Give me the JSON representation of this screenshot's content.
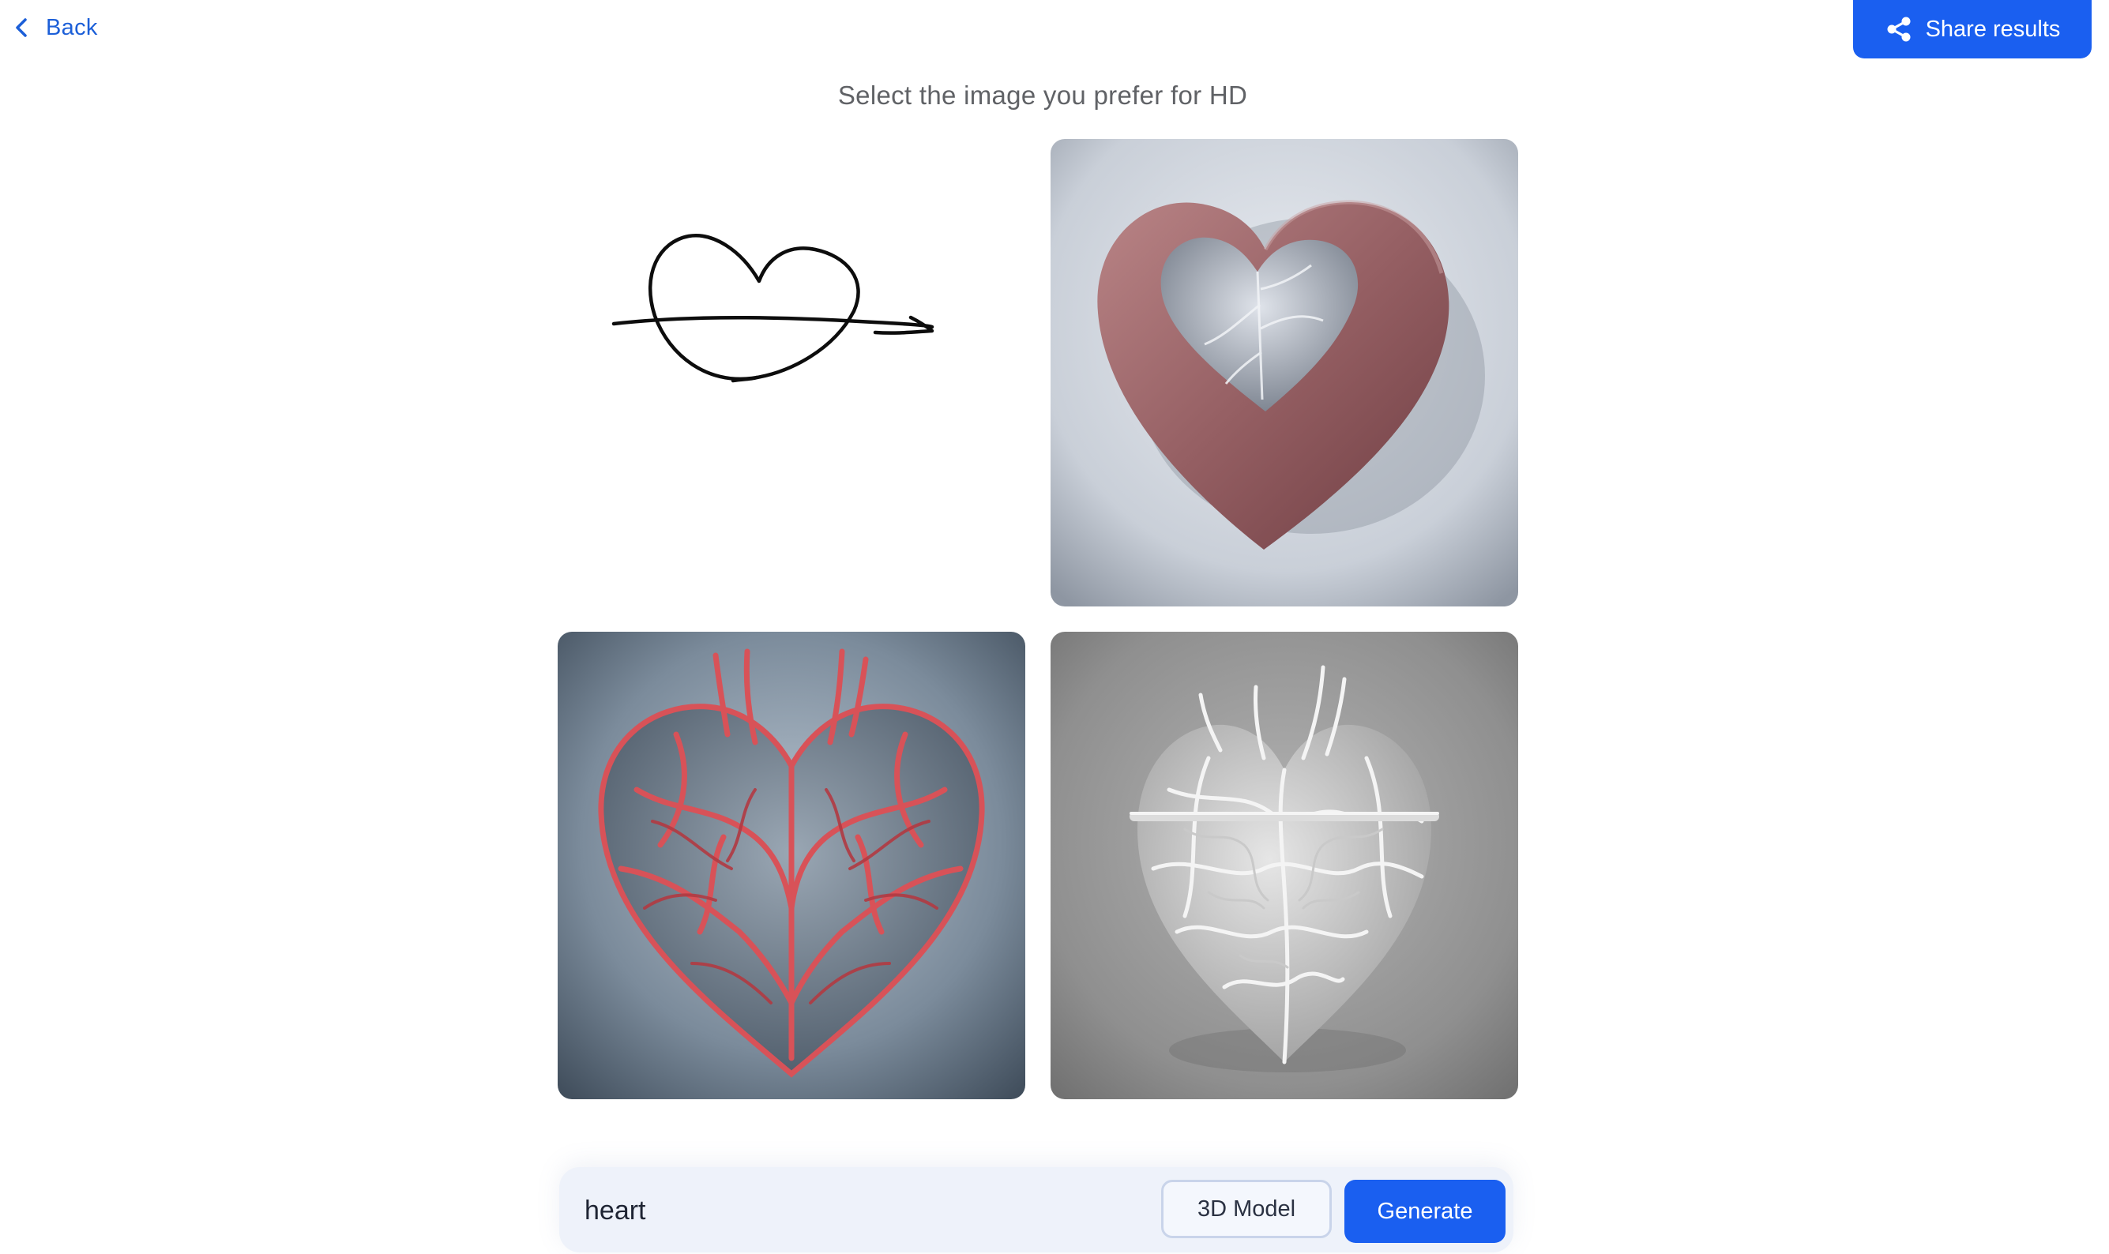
{
  "header": {
    "back_label": "Back",
    "share_label": "Share results"
  },
  "main": {
    "title": "Select the image you prefer for HD",
    "tiles": [
      {
        "name": "input-sketch",
        "icon": "heart-with-arrow-sketch"
      },
      {
        "name": "result-red-hollow-heart",
        "icon": "heart-image"
      },
      {
        "name": "result-red-veins-heart",
        "icon": "heart-image"
      },
      {
        "name": "result-white-veins-heart",
        "icon": "heart-image"
      }
    ]
  },
  "prompt": {
    "value": "heart",
    "model_label": "3D Model",
    "generate_label": "Generate"
  },
  "colors": {
    "accent": "#1a5ff0",
    "link": "#1c5fd8",
    "title_text": "#606266",
    "prompt_bar": "#eef2fa"
  }
}
